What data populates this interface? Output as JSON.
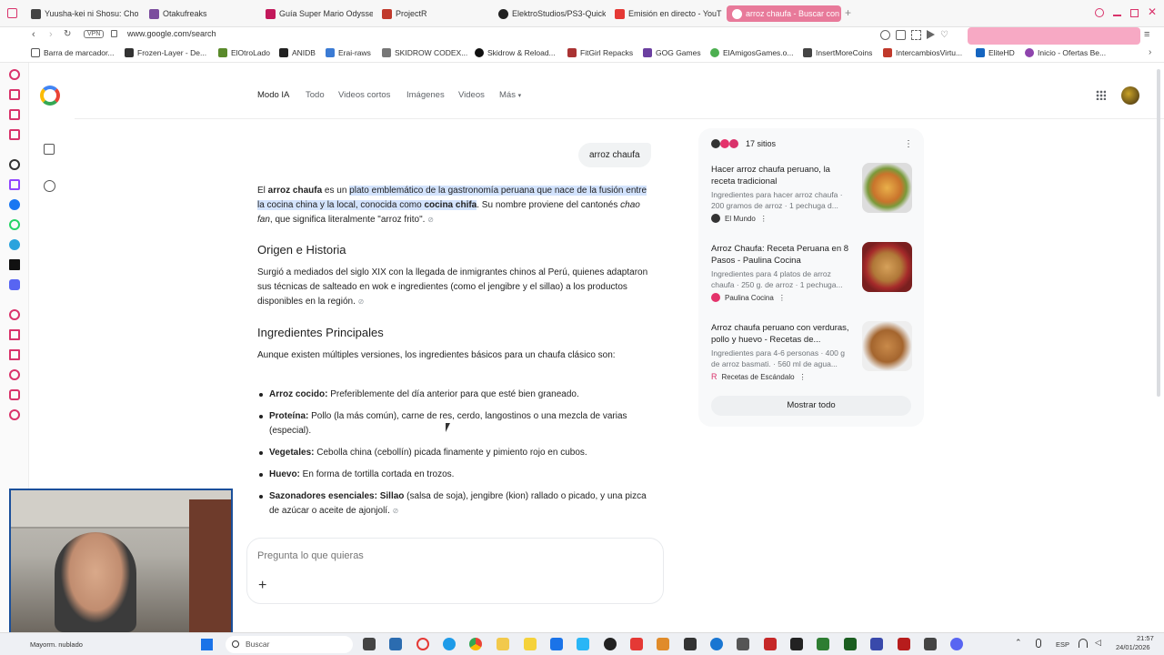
{
  "tabs": [
    {
      "label": "Yuusha-kei ni Shosu: Cho",
      "color": "#444"
    },
    {
      "label": "Otakufreaks",
      "color": "#7b4c9e"
    },
    {
      "label": "Guía Super Mario Odysse",
      "color": "#c2185b"
    },
    {
      "label": "ProjectR",
      "color": "#c0392b"
    },
    {
      "label": "ElektroStudios/PS3-Quick",
      "color": "#222"
    },
    {
      "label": "Emisión en directo - YouT",
      "color": "#e53935"
    },
    {
      "label": "arroz chaufa - Buscar con",
      "color": "#fff"
    }
  ],
  "address": {
    "vpn": "VPN",
    "url": "www.google.com/search"
  },
  "bookmarks": [
    "Barra de marcador...",
    "Frozen-Layer - De...",
    "ElOtroLado",
    "ANIDB",
    "Erai-raws",
    "SKIDROW CODEX...",
    "Skidrow & Reload...",
    "FitGirl Repacks",
    "GOG Games",
    "ElAmigosGames.o...",
    "InsertMoreCoins",
    "IntercambiosVirtu...",
    "EliteHD",
    "Inicio - Ofertas Be..."
  ],
  "google": {
    "nav": [
      "Modo IA",
      "Todo",
      "Videos cortos",
      "Imágenes",
      "Videos",
      "Más"
    ],
    "query": "arroz chaufa",
    "intro": {
      "p1": "El ",
      "bold": "arroz chaufa",
      "p2": " es un ",
      "hl1": "plato emblemático de la gastronomía peruana que nace de la fusión entre la cocina china y la local, conocida como ",
      "hl_bold": "cocina chifa",
      "p3": ". Su nombre proviene del cantonés ",
      "ital": "chao fan",
      "p4": ", que significa literalmente \"arroz frito\"."
    },
    "h_origen": "Origen e Historia",
    "origen": "Surgió a mediados del siglo XIX con la llegada de inmigrantes chinos al Perú, quienes adaptaron sus técnicas de salteado en wok e ingredientes (como el jengibre y el sillao) a los productos disponibles en la región.",
    "h_ingredientes": "Ingredientes Principales",
    "ingredientes_intro": "Aunque existen múltiples versiones, los ingredientes básicos para un chaufa clásico son:",
    "items": [
      {
        "b": "Arroz cocido:",
        "t": " Preferiblemente del día anterior para que esté bien graneado."
      },
      {
        "b": "Proteína:",
        "t": " Pollo (la más común), carne de res, cerdo, langostinos o una mezcla de varias (especial)."
      },
      {
        "b": "Vegetales:",
        "t": " Cebolla china (cebollín) picada finamente y pimiento rojo en cubos."
      },
      {
        "b": "Huevo:",
        "t": " En forma de tortilla cortada en trozos."
      },
      {
        "b": "Sazonadores esenciales: Sillao",
        "t": " (salsa de soja), jengibre (kion) rallado o picado, y una pizca de azúcar o aceite de ajonjolí."
      }
    ],
    "ask_placeholder": "Pregunta lo que quieras",
    "sources_count": "17 sitios",
    "sources": [
      {
        "title": "Hacer arroz chaufa peruano, la receta tradicional",
        "desc": "Ingredientes para hacer arroz chaufa · 200 gramos de arroz · 1 pechuga d...",
        "site": "El Mundo",
        "site_color": "#333"
      },
      {
        "title": "Arroz Chaufa: Receta Peruana en 8 Pasos - Paulina Cocina",
        "desc": "Ingredientes para 4 platos de arroz chaufa · 250 g. de arroz · 1 pechuga...",
        "site": "Paulina Cocina",
        "site_color": "#e4336b"
      },
      {
        "title": "Arroz chaufa peruano con verduras, pollo y huevo - Recetas de...",
        "desc": "Ingredientes para 4-6 personas · 400 g de arroz basmati. · 560 ml de agua...",
        "site": "Recetas de Escándalo",
        "site_color": "#d9336b"
      }
    ],
    "show_all": "Mostrar todo"
  },
  "taskbar": {
    "weather": "Mayorm. nublado",
    "search": "Buscar",
    "lang": "ESP",
    "time": "21:57",
    "date": "24/01/2026"
  }
}
